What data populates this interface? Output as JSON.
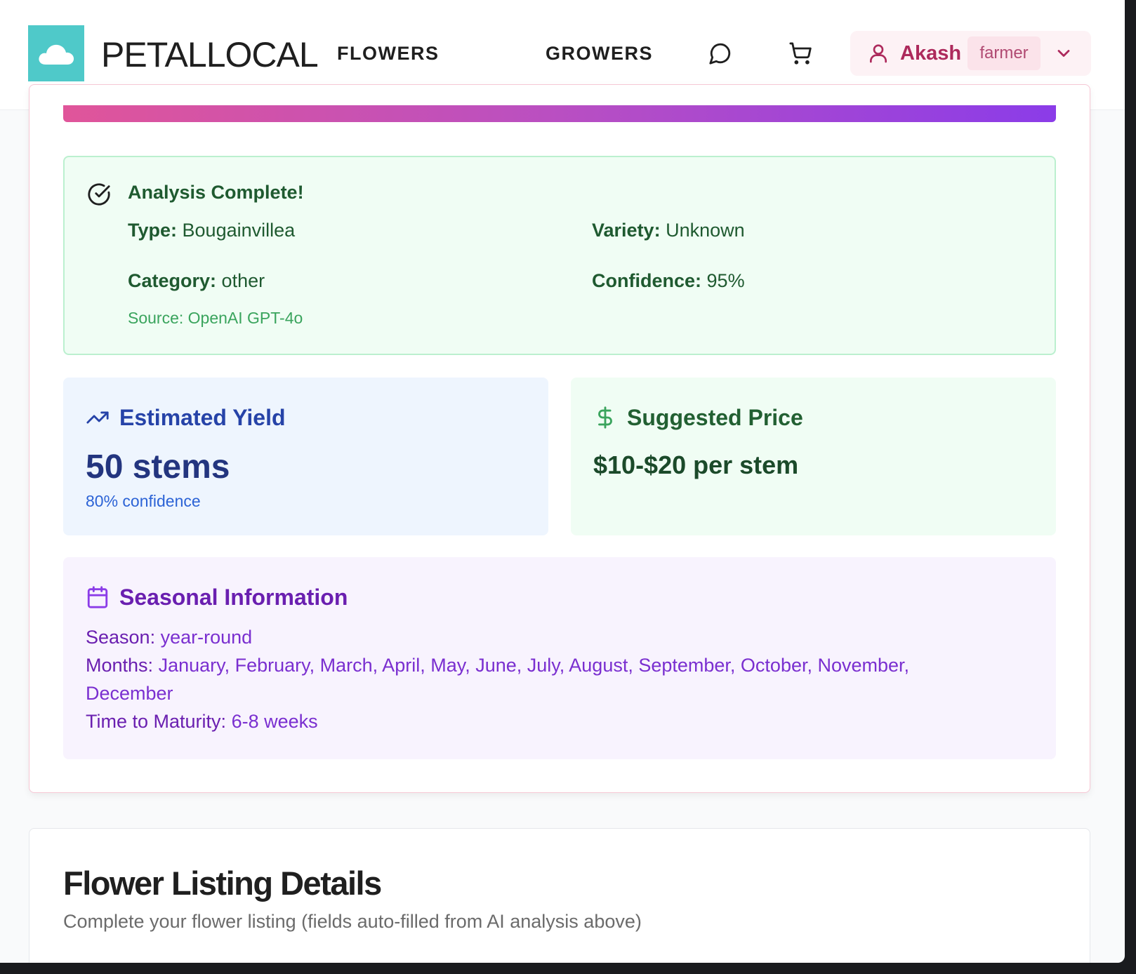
{
  "header": {
    "brand": "PETALLOCAL",
    "nav": {
      "flowers": "FLOWERS",
      "growers": "GROWERS"
    },
    "user": {
      "name": "Akash",
      "role": "farmer"
    }
  },
  "analysis": {
    "title": "Analysis Complete!",
    "type_label": "Type:",
    "type_value": "Bougainvillea",
    "variety_label": "Variety:",
    "variety_value": "Unknown",
    "category_label": "Category:",
    "category_value": "other",
    "confidence_label": "Confidence:",
    "confidence_value": "95%",
    "source": "Source: OpenAI GPT-4o"
  },
  "yield": {
    "title": "Estimated Yield",
    "value": "50 stems",
    "confidence": "80% confidence"
  },
  "price": {
    "title": "Suggested Price",
    "value": "$10-$20 per stem"
  },
  "season": {
    "title": "Seasonal Information",
    "season_label": "Season:",
    "season_value": "year-round",
    "months_label": "Months:",
    "months_value": "January, February, March, April, May, June, July, August, September, October, November, December",
    "maturity_label": "Time to Maturity:",
    "maturity_value": "6-8 weeks"
  },
  "listing": {
    "title": "Flower Listing Details",
    "subtitle": "Complete your flower listing (fields auto-filled from AI analysis above)"
  },
  "colors": {
    "logo_bg": "#4fc9c9",
    "accent_pink": "#ad2a5c",
    "success_green": "#1f5a30",
    "info_blue": "#2643a8",
    "season_purple": "#6a1fb0"
  },
  "icons": [
    "cloud-logo-icon",
    "chat-icon",
    "cart-icon",
    "user-icon",
    "chevron-down-icon",
    "check-circle-icon",
    "trending-up-icon",
    "dollar-icon",
    "calendar-icon"
  ]
}
